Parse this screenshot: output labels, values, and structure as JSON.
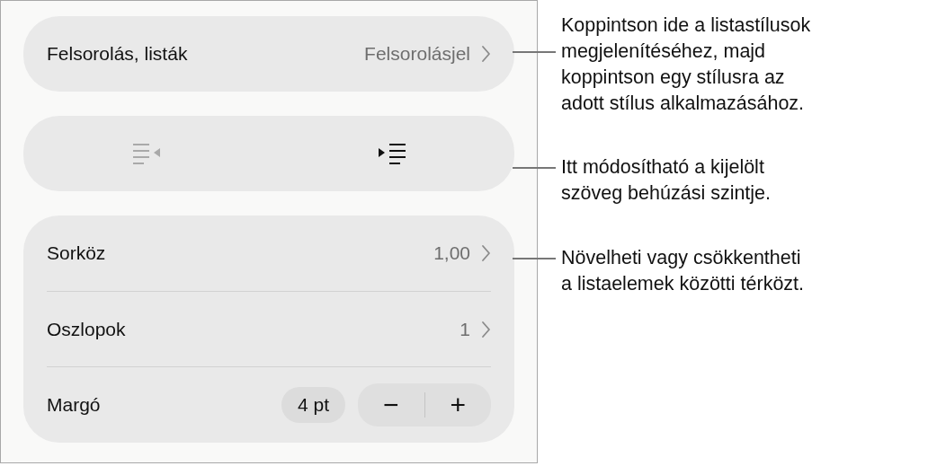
{
  "panel": {
    "list_row": {
      "label": "Felsorolás, listák",
      "value": "Felsorolásjel"
    },
    "indent_buttons": [
      {
        "kind": "outdent",
        "disabled": true
      },
      {
        "kind": "indent",
        "disabled": false
      }
    ],
    "rows": [
      {
        "kind": "disclosure",
        "label": "Sorköz",
        "value": "1,00"
      },
      {
        "kind": "disclosure",
        "label": "Oszlopok",
        "value": "1"
      },
      {
        "kind": "stepper",
        "label": "Margó",
        "value": "4 pt",
        "minus": "−",
        "plus": "+"
      }
    ]
  },
  "callouts": [
    {
      "text": "Koppintson ide a listastílusok\nmegjelenítéséhez, majd\nkoppintson egy stílusra az\nadott stílus alkalmazásához."
    },
    {
      "text": "Itt módosítható a kijelölt\nszöveg behúzási szintje."
    },
    {
      "text": "Növelheti vagy csökkentheti\na listaelemek közötti térközt."
    }
  ]
}
